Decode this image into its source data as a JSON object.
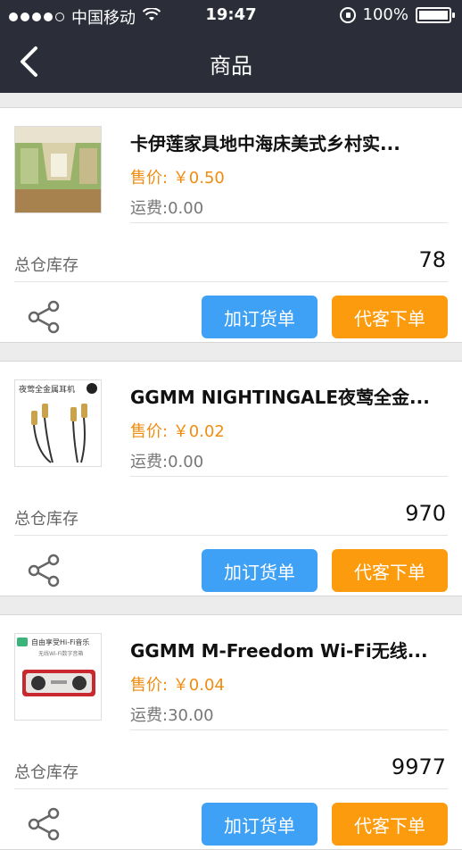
{
  "status": {
    "carrier": "中国移动",
    "time": "19:47",
    "battery": "100%",
    "battery_level": 1.0
  },
  "nav": {
    "title": "商品"
  },
  "products": [
    {
      "name": "卡伊莲家具地中海床美式乡村实...",
      "price": "售价: ￥0.50",
      "shipping": "运费:0.00",
      "stock_label": "总仓库存",
      "stock": "78",
      "add_order": "加订货单",
      "proxy_order": "代客下单"
    },
    {
      "name": "GGMM NIGHTINGALE夜莺全金...",
      "price": "售价: ￥0.02",
      "shipping": "运费:0.00",
      "stock_label": "总仓库存",
      "stock": "970",
      "add_order": "加订货单",
      "proxy_order": "代客下单"
    },
    {
      "name": "GGMM M-Freedom Wi-Fi无线...",
      "price": "售价: ￥0.04",
      "shipping": "运费:30.00",
      "stock_label": "总仓库存",
      "stock": "9977",
      "add_order": "加订货单",
      "proxy_order": "代客下单"
    }
  ],
  "thumb_texts": {
    "p2": "夜莺全金属耳机",
    "p3_title": "自由享受Hi-Fi音乐",
    "p3_sub": "无线Wi-Fi数字音箱"
  },
  "colors": {
    "nav_bg": "#2b2e38",
    "price": "#f08c10",
    "btn_blue": "#3ea1f5",
    "btn_orange": "#fb9b0d"
  },
  "icons": {
    "back": "chevron-left-icon",
    "share": "share-icon",
    "wifi": "wifi-icon",
    "orientation_lock": "rotation-lock-icon",
    "battery": "battery-icon"
  }
}
